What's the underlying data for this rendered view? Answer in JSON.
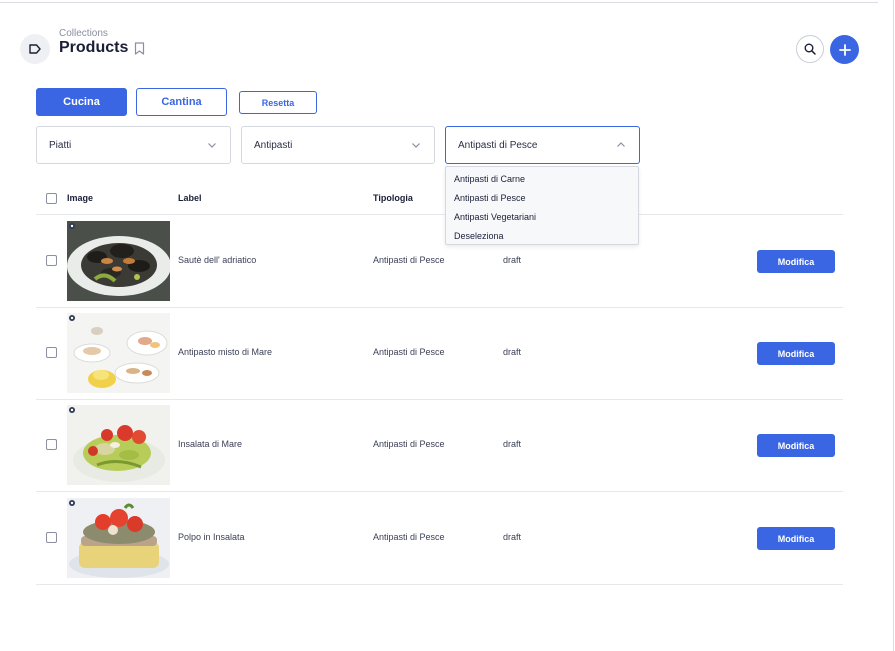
{
  "header": {
    "breadcrumb": "Collections",
    "title": "Products"
  },
  "filters": {
    "tabs": [
      {
        "label": "Cucina",
        "active": true
      },
      {
        "label": "Cantina",
        "active": false
      }
    ],
    "reset_label": "Resetta",
    "selects": [
      {
        "value": "Piatti"
      },
      {
        "value": "Antipasti"
      },
      {
        "value": "Antipasti di Pesce",
        "open": true
      }
    ],
    "dropdown_options": [
      "Antipasti di Carne",
      "Antipasti di Pesce",
      "Antipasti Vegetariani",
      "Deseleziona"
    ]
  },
  "table": {
    "columns": [
      "Image",
      "Label",
      "Tipologia"
    ],
    "edit_label": "Modifica",
    "rows": [
      {
        "label": "Sautè dell' adriatico",
        "tipologia": "Antipasti di Pesce",
        "status": "draft",
        "image": "mussels-dish"
      },
      {
        "label": "Antipasto misto di Mare",
        "tipologia": "Antipasti di Pesce",
        "status": "draft",
        "image": "mixed-seafood-plates"
      },
      {
        "label": "Insalata di Mare",
        "tipologia": "Antipasti di Pesce",
        "status": "draft",
        "image": "seafood-salad"
      },
      {
        "label": "Polpo in Insalata",
        "tipologia": "Antipasti di Pesce",
        "status": "draft",
        "image": "octopus-salad"
      }
    ]
  },
  "colors": {
    "accent": "#3b66e3",
    "border": "#d5d8de",
    "text": "#1a1f36"
  }
}
